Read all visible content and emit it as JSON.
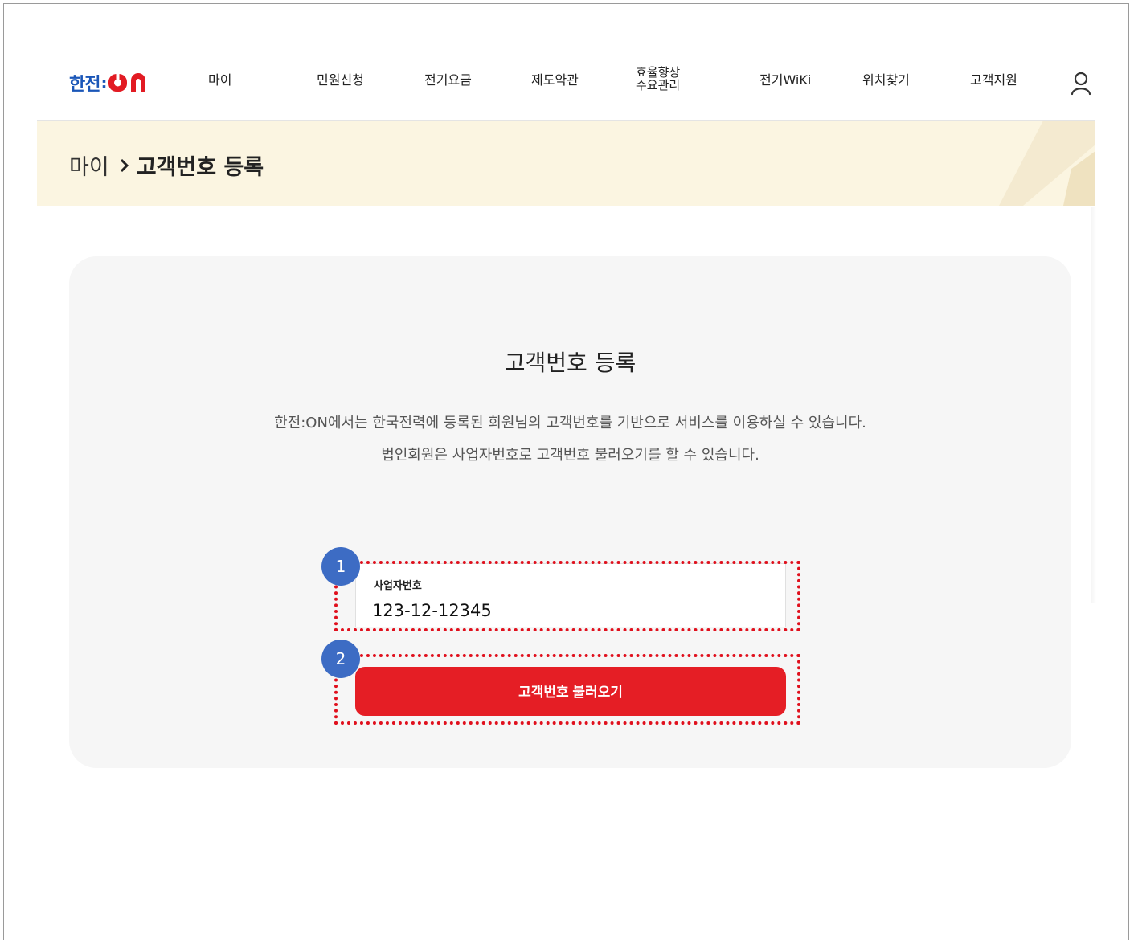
{
  "header": {
    "logo": {
      "han": "한전",
      "colon": ":",
      "on": "ON"
    },
    "nav": [
      {
        "label": "마이"
      },
      {
        "label": "민원신청"
      },
      {
        "label": "전기요금"
      },
      {
        "label": "제도약관"
      },
      {
        "label_line1": "효율향상",
        "label_line2": "수요관리"
      },
      {
        "label": "전기WiKi"
      },
      {
        "label": "위치찾기"
      },
      {
        "label": "고객지원"
      }
    ],
    "user_icon": "user-icon"
  },
  "breadcrumb": {
    "home": "마이",
    "separator_icon": "chevron-right-icon",
    "current": "고객번호 등록"
  },
  "card": {
    "title": "고객번호 등록",
    "description_line1": "한전:ON에서는 한국전력에 등록된 회원님의 고객번호를 기반으로 서비스를 이용하실 수 있습니다.",
    "description_line2": "법인회원은 사업자번호로 고객번호 불러오기를 할 수 있습니다.",
    "input": {
      "label": "사업자번호",
      "value": "123-12-12345"
    },
    "button_label": "고객번호 불러오기"
  },
  "annotations": {
    "badge1": "1",
    "badge2": "2",
    "outline_color": "#e0101d",
    "badge_color": "#3d6cc4"
  },
  "colors": {
    "brand_blue": "#1a56b8",
    "brand_red": "#e21b23",
    "button_red": "#e51e25",
    "crumb_band": "#fbf5e1",
    "card_bg": "#f6f6f6"
  }
}
